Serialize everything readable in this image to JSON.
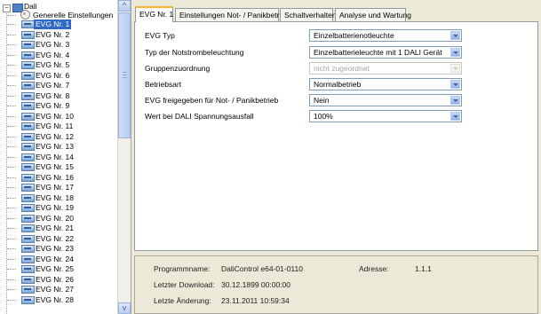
{
  "tree": {
    "root_label": "Dali",
    "general_label": "Generelle Einstellungen",
    "items": [
      "EVG Nr. 1",
      "EVG Nr. 2",
      "EVG Nr. 3",
      "EVG Nr. 4",
      "EVG Nr. 5",
      "EVG Nr. 6",
      "EVG Nr. 7",
      "EVG Nr. 8",
      "EVG Nr. 9",
      "EVG Nr. 10",
      "EVG Nr. 11",
      "EVG Nr. 12",
      "EVG Nr. 13",
      "EVG Nr. 14",
      "EVG Nr. 15",
      "EVG Nr. 16",
      "EVG Nr. 17",
      "EVG Nr. 18",
      "EVG Nr. 19",
      "EVG Nr. 20",
      "EVG Nr. 21",
      "EVG Nr. 22",
      "EVG Nr. 23",
      "EVG Nr. 24",
      "EVG Nr. 25",
      "EVG Nr. 26",
      "EVG Nr. 27",
      "EVG Nr. 28"
    ],
    "selected_index": 0
  },
  "tabs": [
    {
      "label": "EVG Nr. 1",
      "active": true
    },
    {
      "label": "Einstellungen Not- / Panikbetrieb",
      "active": false
    },
    {
      "label": "Schaltverhalten",
      "active": false
    },
    {
      "label": "Analyse und Wartung",
      "active": false
    }
  ],
  "form": [
    {
      "label": "EVG Typ",
      "value": "Einzelbatterienotleuchte",
      "disabled": false
    },
    {
      "label": "Typ der Notstrombeleuchtung",
      "value": "Einzelbatterieleuchte mit 1 DALI Gerät",
      "disabled": false
    },
    {
      "label": "Gruppenzuordnung",
      "value": "nicht zugeordnet",
      "disabled": true
    },
    {
      "label": "Betriebsart",
      "value": "Normalbetrieb",
      "disabled": false
    },
    {
      "label": "EVG freigegeben für Not- / Panikbetrieb",
      "value": "Nein",
      "disabled": false
    },
    {
      "label": "Wert bei DALI Spannungsausfall",
      "value": "100%",
      "disabled": false
    }
  ],
  "info": {
    "program_label": "Programmname:",
    "program_value": "DaliControl e64-01-0110",
    "address_label": "Adresse:",
    "address_value": "1.1.1",
    "download_label": "Letzter Download:",
    "download_value": "30.12.1899 00:00:00",
    "change_label": "Letzte Änderung:",
    "change_value": "23.11.2011 10:59:34"
  },
  "icons": {
    "expander": "minus-icon",
    "root": "dali-folder-icon",
    "general": "settings-gear-icon",
    "device": "ballast-device-icon",
    "scroll_up": "chevron-up-icon",
    "scroll_down": "chevron-down-icon",
    "dropdown": "dropdown-arrow-icon"
  },
  "colors": {
    "selection": "#316ac5",
    "active_tab_highlight": "#f3b438",
    "window_background": "#ece9d8"
  }
}
